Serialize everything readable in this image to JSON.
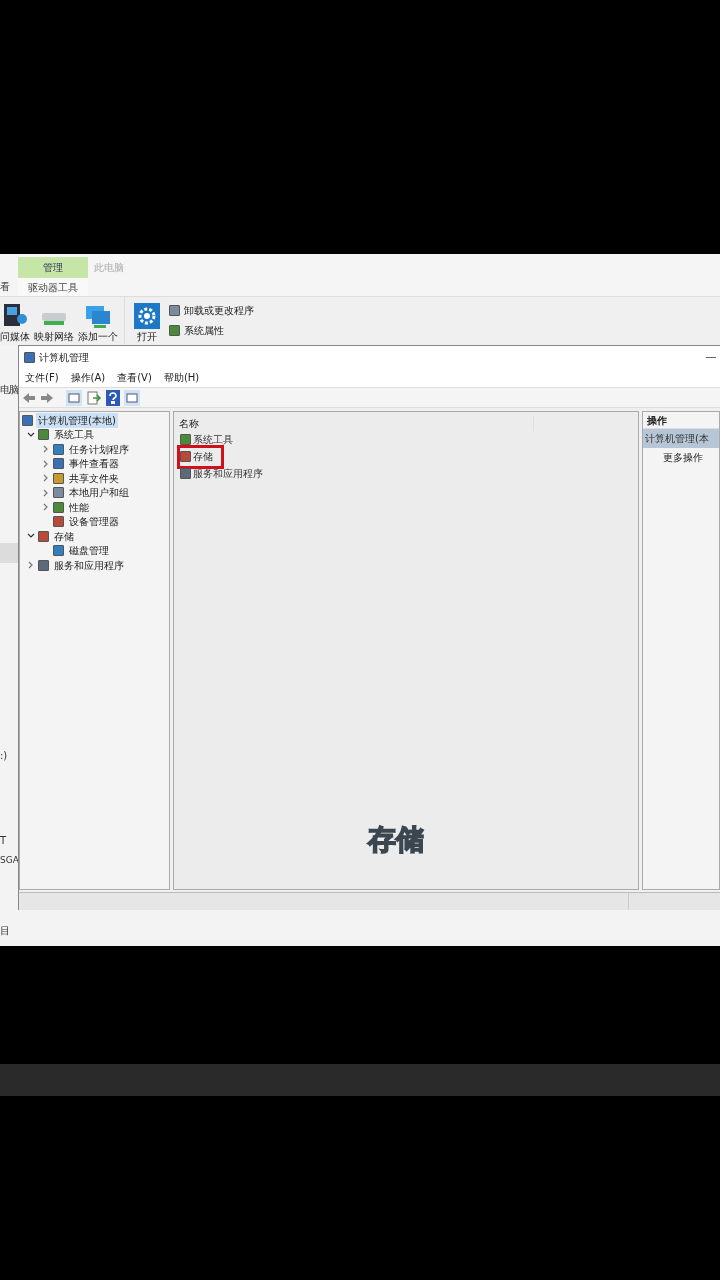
{
  "explorer": {
    "ribbon_tabs": [
      {
        "label": "管理",
        "selected": true
      },
      {
        "label": "此电脑",
        "selected": false
      }
    ],
    "left_tab": "看",
    "context_label": "驱动器工具",
    "ribbon_buttons": [
      {
        "label": "问媒体",
        "kind": "media"
      },
      {
        "label": "映射网络",
        "kind": "drive"
      },
      {
        "label": "添加一个",
        "kind": "monitor"
      },
      {
        "label": "打开",
        "kind": "settings"
      }
    ],
    "ribbon_links": [
      "卸载或更改程序",
      "系统属性"
    ],
    "nav_fragments": [
      "电脑",
      ":)",
      "T",
      "SGA",
      "目"
    ]
  },
  "window": {
    "title": "计算机管理",
    "menu": [
      "文件(F)",
      "操作(A)",
      "查看(V)",
      "帮助(H)"
    ],
    "tree": [
      {
        "label": "计算机管理(本地)",
        "selected": true,
        "children": [
          {
            "label": "系统工具",
            "expanded": true,
            "children": [
              {
                "label": "任务计划程序",
                "expanded": false
              },
              {
                "label": "事件查看器",
                "expanded": false
              },
              {
                "label": "共享文件夹",
                "expanded": false
              },
              {
                "label": "本地用户和组",
                "expanded": false
              },
              {
                "label": "性能",
                "expanded": false
              },
              {
                "label": "设备管理器"
              }
            ]
          },
          {
            "label": "存储",
            "expanded": true,
            "children": [
              {
                "label": "磁盘管理"
              }
            ]
          },
          {
            "label": "服务和应用程序",
            "expanded": false
          }
        ]
      }
    ],
    "list": {
      "columns": [
        "名称"
      ],
      "rows": [
        {
          "label": "系统工具",
          "highlighted": false
        },
        {
          "label": "存储",
          "highlighted": true
        },
        {
          "label": "服务和应用程序",
          "highlighted": false
        }
      ]
    },
    "actions": {
      "header": "操作",
      "section": "计算机管理(本",
      "items": [
        "更多操作"
      ]
    }
  },
  "caption": "存储"
}
